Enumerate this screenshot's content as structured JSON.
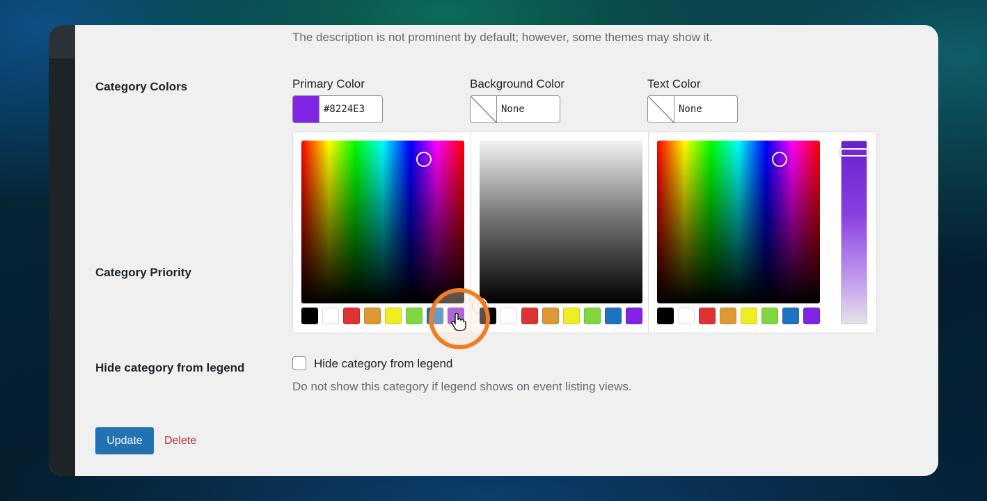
{
  "description_hint": "The description is not prominent by default; however, some themes may show it.",
  "category_colors": {
    "label": "Category Colors",
    "fields": [
      {
        "label": "Primary Color",
        "value": "#8224E3",
        "swatch": "#8224E3"
      },
      {
        "label": "Background Color",
        "value": "None",
        "swatch": "none"
      },
      {
        "label": "Text Color",
        "value": "None",
        "swatch": "none"
      }
    ],
    "palette": [
      "#000000",
      "#ffffff",
      "#dd3333",
      "#dd9933",
      "#eeee22",
      "#81d742",
      "#1e73be",
      "#8224e3"
    ]
  },
  "category_priority": {
    "label": "Category Priority"
  },
  "hide_legend": {
    "label": "Hide category from legend",
    "checkbox_label": "Hide category from legend",
    "checked": false,
    "description": "Do not show this category if legend shows on event listing views."
  },
  "actions": {
    "update": "Update",
    "delete": "Delete"
  },
  "cursor": {
    "icon": "hand-pointer-icon"
  }
}
